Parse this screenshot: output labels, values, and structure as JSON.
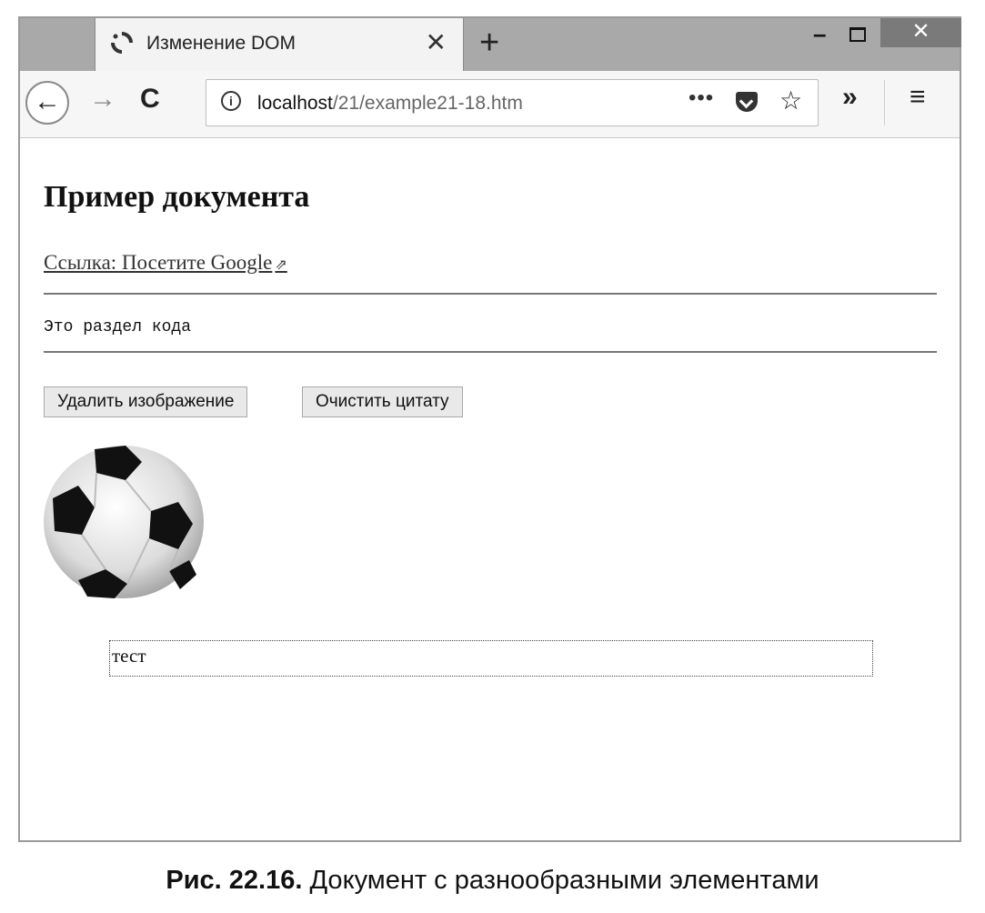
{
  "tab": {
    "title": "Изменение DOM",
    "close": "✕"
  },
  "newtab": "+",
  "window_controls": {
    "minimize": "–",
    "close": "✕"
  },
  "address": {
    "host": "localhost",
    "path": "/21/example21-18.htm"
  },
  "toolbar": {
    "back": "←",
    "forward": "→",
    "reload": "C",
    "more": "•••",
    "star": "☆",
    "overflow": "»",
    "menu": "≡"
  },
  "page": {
    "heading": "Пример документа",
    "link": "Ссылка: Посетите Google",
    "code": "Это раздел кода",
    "buttons": [
      "Удалить изображение",
      "Очистить цитату"
    ],
    "quote": "тест"
  },
  "caption": {
    "label": "Рис. 22.16.",
    "text": "Документ с разнообразными элементами"
  }
}
